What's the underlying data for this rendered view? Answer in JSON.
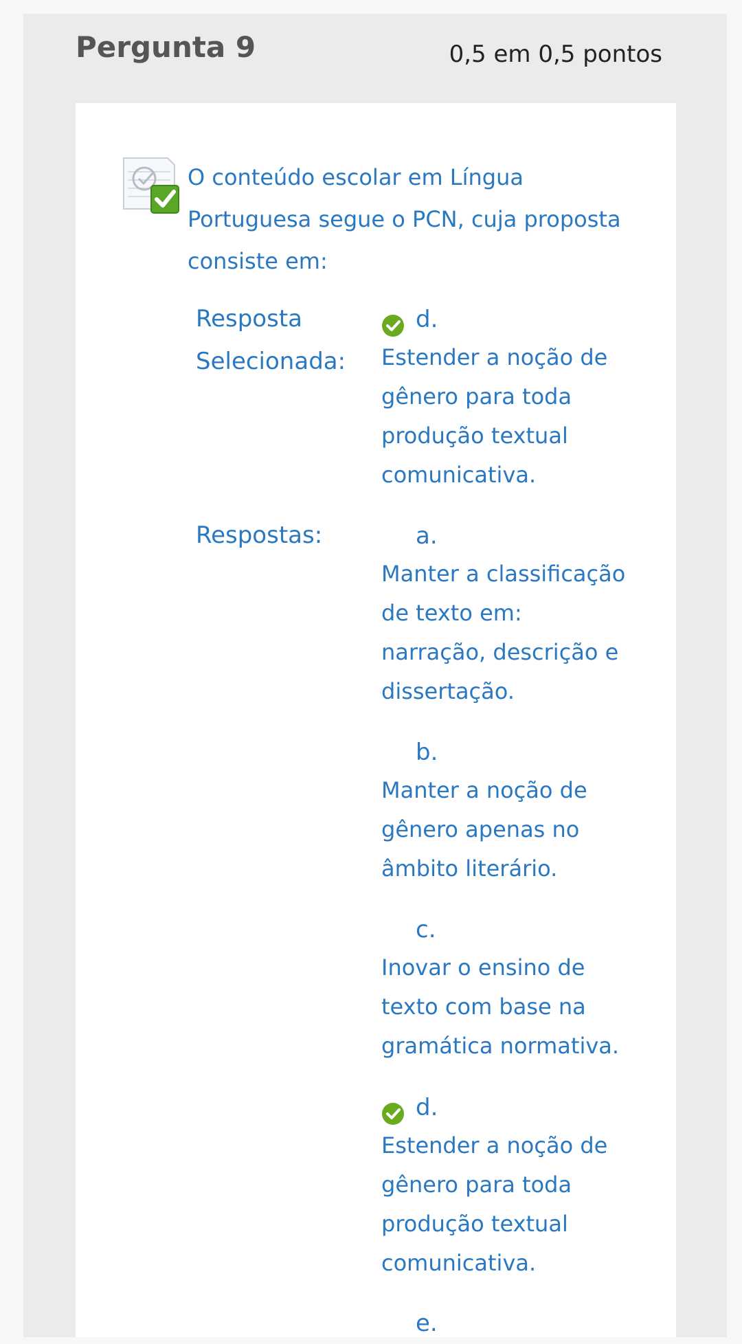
{
  "question": {
    "title": "Pergunta 9",
    "points": "0,5 em 0,5 pontos",
    "text": "O conteúdo escolar em Língua Portuguesa segue o PCN, cuja proposta consiste em:",
    "icon": "correct-question-icon"
  },
  "selected": {
    "label": "Resposta Selecionada:",
    "letter": "d.",
    "text": "Estender a noção de gênero para toda produção textual comunicativa.",
    "icon": "check-icon"
  },
  "answers": {
    "label": "Respostas:",
    "items": [
      {
        "letter": "a.",
        "text": "Manter a classificação de texto em: narração, descrição e dissertação.",
        "correct": false
      },
      {
        "letter": "b.",
        "text": "Manter a noção de gênero apenas no âmbito literário.",
        "correct": false
      },
      {
        "letter": "c.",
        "text": "Inovar o ensino de texto com base na gramática normativa.",
        "correct": false
      },
      {
        "letter": "d.",
        "text": "Estender a noção de gênero para toda produção textual comunicativa.",
        "correct": true
      },
      {
        "letter": "e.",
        "text": "",
        "correct": false
      }
    ]
  },
  "colors": {
    "link_blue": "#2a78c2",
    "check_green": "#6aaa1e",
    "panel_gray": "#ebebeb"
  }
}
